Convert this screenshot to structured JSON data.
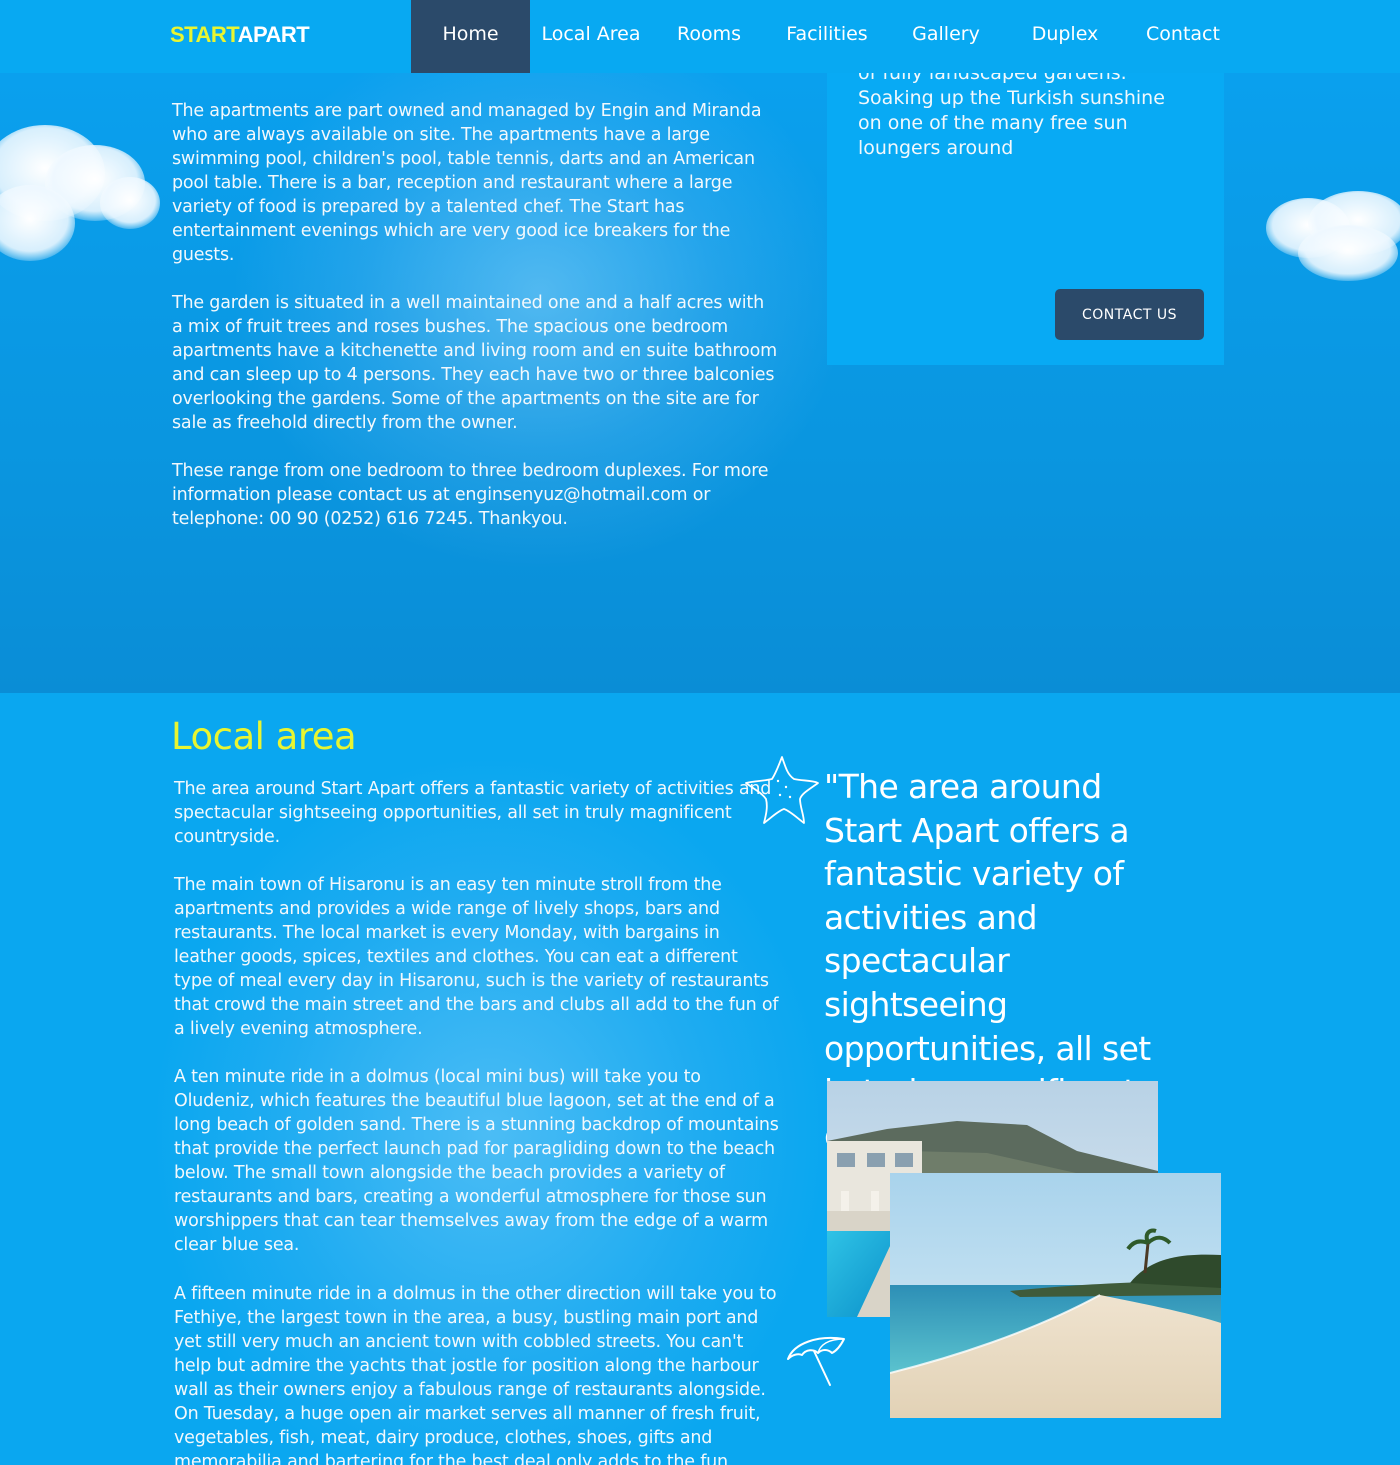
{
  "nav": {
    "logo_start": "START",
    "logo_apart": "APART",
    "items": [
      "Home",
      "Local Area",
      "Rooms",
      "Facilities",
      "Gallery",
      "Duplex",
      "Contact"
    ],
    "active": "Home"
  },
  "intro": {
    "paragraphs": [
      "The apartments are part owned and managed by Engin and Miranda who are always available on site. The apartments have a large swimming pool, children's pool, table tennis, darts and an American pool table. There is a bar, reception and restaurant where a large variety of food is prepared by a talented chef. The Start has entertainment evenings which are very good ice breakers for the guests.",
      "The garden is situated in a well maintained one and a half acres with a mix of fruit trees and roses bushes. The spacious one bedroom apartments have a kitchenette and living room and en suite bathroom and can sleep up to 4 persons. They each have two or three balconies overlooking the gardens. Some of the apartments on the site are for sale as freehold directly from the owner.",
      "These range from one bedroom to three bedroom duplexes. For more information please contact us at enginsenyuz@hotmail.com or telephone: 00 90 (0252) 616 7245. Thankyou."
    ]
  },
  "infobox": {
    "text": "of fully landscaped gardens. Soaking up the Turkish sunshine on one of the many free sun loungers around",
    "button": "CONTACT US"
  },
  "local_area": {
    "title": "Local area",
    "paragraphs": [
      "The area around Start Apart offers a fantastic variety of activities and spectacular sightseeing opportunities, all set in truly magnificent countryside.",
      "The main town of Hisaronu is an easy ten minute stroll from the apartments and provides a wide range of lively shops, bars and restaurants. The local market is every Monday, with bargains in leather goods, spices, textiles and clothes. You can eat a different type of meal every day in Hisaronu, such is the variety of restaurants that crowd the main street and the bars and clubs all add to the fun of a lively evening atmosphere.",
      "A ten minute ride in a dolmus (local mini bus) will take you to Oludeniz, which features the beautiful blue lagoon, set at the end of a long beach of golden sand. There is a stunning backdrop of mountains that provide the perfect launch pad for paragliding down to the beach below. The small town alongside the beach provides a variety of restaurants and bars, creating a wonderful atmosphere for those sun worshippers that can tear themselves away from the edge of a warm clear blue sea.",
      "A fifteen minute ride in a dolmus in the other direction will take you to Fethiye, the largest town in the area, a busy, bustling main port and yet still very much an ancient town with cobbled streets. You can't help but admire the yachts that jostle for position along the harbour wall as their owners enjoy a fabulous range of restaurants alongside. On Tuesday, a huge open air market serves all manner of fresh fruit, vegetables, fish, meat, dairy produce, clothes, shoes, gifts and memorabilia and bartering for the best deal only adds to the fun"
    ],
    "quote": "\"The area around Start Apart offers a fantastic variety of activities and spectacular sightseeing opportunities, all set in truly magnificent countryside.\""
  },
  "colors": {
    "nav_bg": "#08a9f2",
    "active_bg": "#2b4a6a",
    "accent_yellow": "#e8f531",
    "section_bg": "#0aa7f0"
  }
}
